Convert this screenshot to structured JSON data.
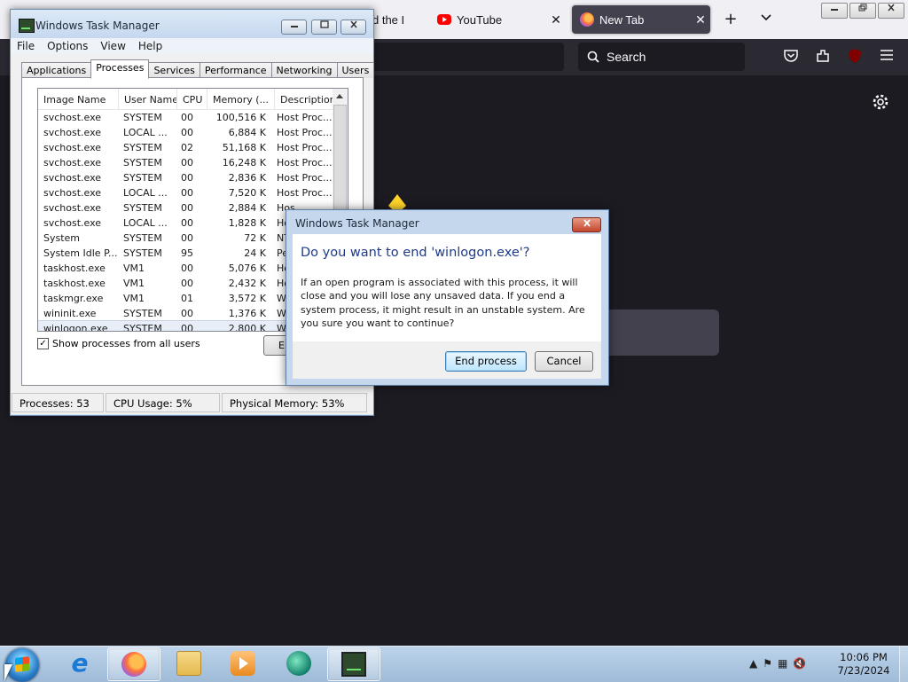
{
  "browser": {
    "tabs": [
      {
        "label": "d the I",
        "icon": "generic-page-icon"
      },
      {
        "label": "YouTube",
        "icon": "youtube-icon"
      },
      {
        "label": "New Tab",
        "icon": "firefox-icon",
        "active": true
      }
    ],
    "search_placeholder": "Search",
    "new_tab_symbol": "+",
    "tab_list_symbol": "⌄",
    "close_symbol": "✕"
  },
  "task_manager": {
    "title": "Windows Task Manager",
    "menu": [
      "File",
      "Options",
      "View",
      "Help"
    ],
    "tabs": [
      "Applications",
      "Processes",
      "Services",
      "Performance",
      "Networking",
      "Users"
    ],
    "selected_tab": "Processes",
    "columns": [
      "Image Name",
      "User Name",
      "CPU",
      "Memory (...",
      "Description"
    ],
    "processes": [
      {
        "image": "svchost.exe",
        "user": "SYSTEM",
        "cpu": "00",
        "memory": "100,516 K",
        "desc": "Host Proc..."
      },
      {
        "image": "svchost.exe",
        "user": "LOCAL ...",
        "cpu": "00",
        "memory": "6,884 K",
        "desc": "Host Proc..."
      },
      {
        "image": "svchost.exe",
        "user": "SYSTEM",
        "cpu": "02",
        "memory": "51,168 K",
        "desc": "Host Proc..."
      },
      {
        "image": "svchost.exe",
        "user": "SYSTEM",
        "cpu": "00",
        "memory": "16,248 K",
        "desc": "Host Proc..."
      },
      {
        "image": "svchost.exe",
        "user": "SYSTEM",
        "cpu": "00",
        "memory": "2,836 K",
        "desc": "Host Proc..."
      },
      {
        "image": "svchost.exe",
        "user": "LOCAL ...",
        "cpu": "00",
        "memory": "7,520 K",
        "desc": "Host Proc..."
      },
      {
        "image": "svchost.exe",
        "user": "SYSTEM",
        "cpu": "00",
        "memory": "2,884 K",
        "desc": "Hos"
      },
      {
        "image": "svchost.exe",
        "user": "LOCAL ...",
        "cpu": "00",
        "memory": "1,828 K",
        "desc": "Hos"
      },
      {
        "image": "System",
        "user": "SYSTEM",
        "cpu": "00",
        "memory": "72 K",
        "desc": "NT"
      },
      {
        "image": "System Idle P...",
        "user": "SYSTEM",
        "cpu": "95",
        "memory": "24 K",
        "desc": "Per"
      },
      {
        "image": "taskhost.exe",
        "user": "VM1",
        "cpu": "00",
        "memory": "5,076 K",
        "desc": "Hos"
      },
      {
        "image": "taskhost.exe",
        "user": "VM1",
        "cpu": "00",
        "memory": "2,432 K",
        "desc": "Hos"
      },
      {
        "image": "taskmgr.exe",
        "user": "VM1",
        "cpu": "01",
        "memory": "3,572 K",
        "desc": "Win"
      },
      {
        "image": "wininit.exe",
        "user": "SYSTEM",
        "cpu": "00",
        "memory": "1,376 K",
        "desc": "Win"
      },
      {
        "image": "winlogon.exe",
        "user": "SYSTEM",
        "cpu": "00",
        "memory": "2,800 K",
        "desc": "Win",
        "selected": true
      }
    ],
    "show_all_label": "Show processes from all users",
    "show_all_checked": true,
    "end_process_label": "End Process",
    "status": {
      "processes": "Processes: 53",
      "cpu": "CPU Usage: 5%",
      "memory": "Physical Memory: 53%"
    }
  },
  "dialog": {
    "title": "Windows Task Manager",
    "heading": "Do you want to end 'winlogon.exe'?",
    "message": "If an open program is associated with this process, it will close and you will lose any unsaved data. If you end a system process, it might result in an unstable system. Are you sure you want to continue?",
    "confirm_label": "End process",
    "cancel_label": "Cancel"
  },
  "taskbar": {
    "items": [
      "internet-explorer-icon",
      "firefox-icon",
      "file-explorer-icon",
      "media-player-icon",
      "green-app-icon",
      "task-manager-icon"
    ],
    "active_items": [
      "firefox-icon",
      "task-manager-icon"
    ],
    "time": "10:06 PM",
    "date": "7/23/2024"
  }
}
